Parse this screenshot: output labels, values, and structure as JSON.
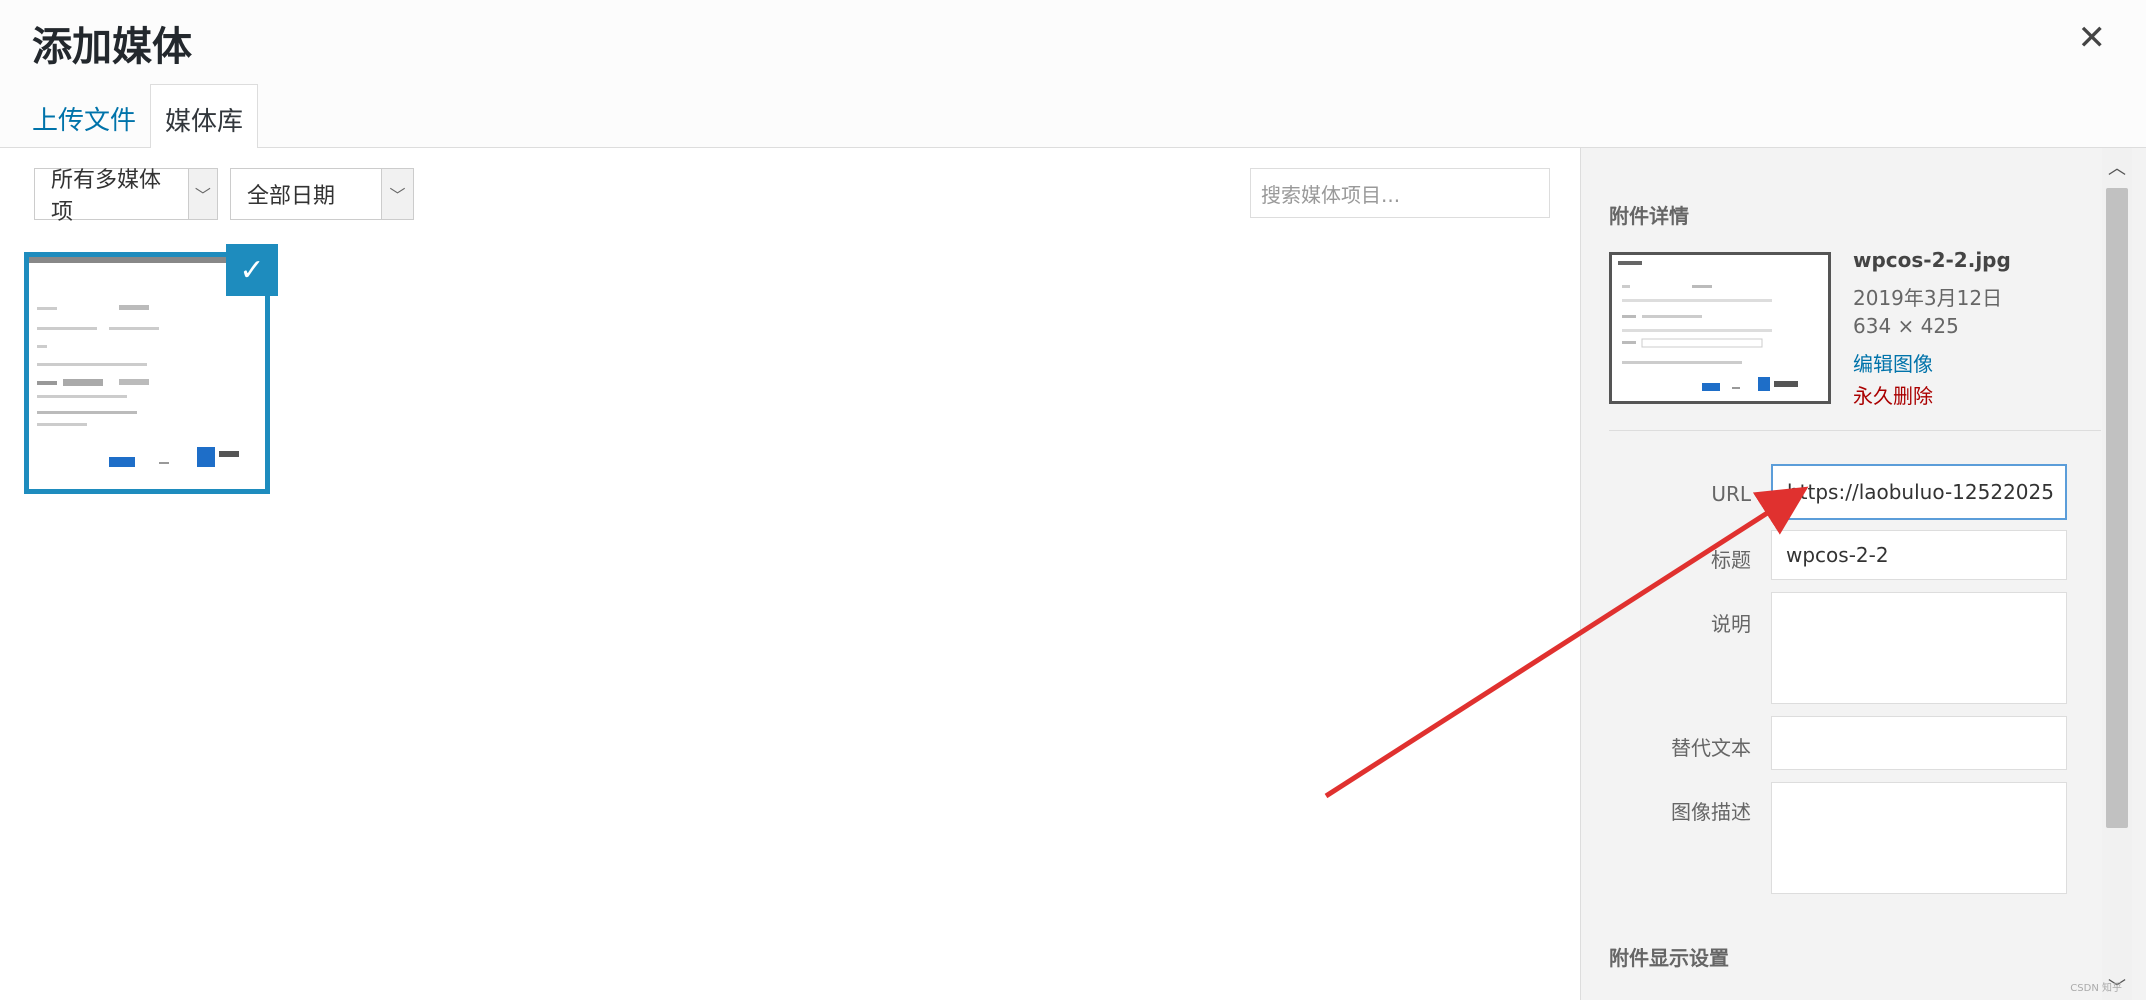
{
  "header": {
    "title": "添加媒体",
    "close": "✕"
  },
  "tabs": [
    {
      "label": "上传文件"
    },
    {
      "label": "媒体库"
    }
  ],
  "filters": {
    "type_value": "所有多媒体项",
    "date_value": "全部日期",
    "search_placeholder": "搜索媒体项目..."
  },
  "sidebar": {
    "details_heading": "附件详情",
    "filename": "wpcos-2-2.jpg",
    "date": "2019年3月12日",
    "dimensions": "634 × 425",
    "edit_link": "编辑图像",
    "delete_link": "永久删除",
    "fields": {
      "url": {
        "label": "URL",
        "value": "https://laobuluo-12522025"
      },
      "title": {
        "label": "标题",
        "value": "wpcos-2-2"
      },
      "caption": {
        "label": "说明",
        "value": ""
      },
      "alt": {
        "label": "替代文本",
        "value": ""
      },
      "description": {
        "label": "图像描述",
        "value": ""
      }
    },
    "display_heading": "附件显示设置"
  },
  "watermark": "CSDN 知乎",
  "colors": {
    "accent": "#1e8cbe",
    "link": "#0073aa",
    "danger": "#a00",
    "arrow": "#e0312f"
  }
}
